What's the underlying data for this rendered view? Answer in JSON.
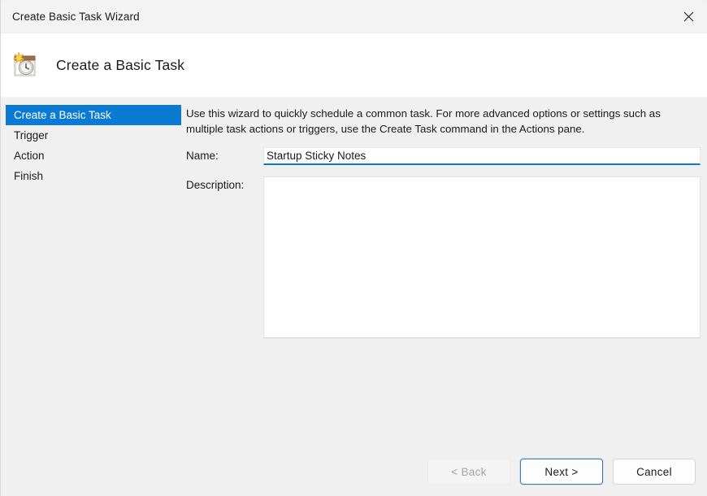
{
  "window": {
    "title": "Create Basic Task Wizard",
    "close_icon": "close-icon"
  },
  "header": {
    "title": "Create a Basic Task",
    "icon": "task-scheduler-new-task-icon"
  },
  "sidebar": {
    "items": [
      {
        "label": "Create a Basic Task",
        "selected": true
      },
      {
        "label": "Trigger",
        "selected": false
      },
      {
        "label": "Action",
        "selected": false
      },
      {
        "label": "Finish",
        "selected": false
      }
    ]
  },
  "content": {
    "intro": "Use this wizard to quickly schedule a common task.  For more advanced options or settings such as multiple task actions or triggers, use the Create Task command in the Actions pane.",
    "name_label": "Name:",
    "name_value": "Startup Sticky Notes",
    "name_placeholder": "",
    "description_label": "Description:",
    "description_value": "",
    "description_placeholder": ""
  },
  "footer": {
    "back_label": "< Back",
    "next_label": "Next >",
    "cancel_label": "Cancel"
  },
  "colors": {
    "accent": "#0b7ad3",
    "window_background": "#f0f0f0",
    "titlebar_background": "#f3f3f3",
    "header_background": "#ffffff",
    "default_button_border": "#3b7cb5"
  }
}
